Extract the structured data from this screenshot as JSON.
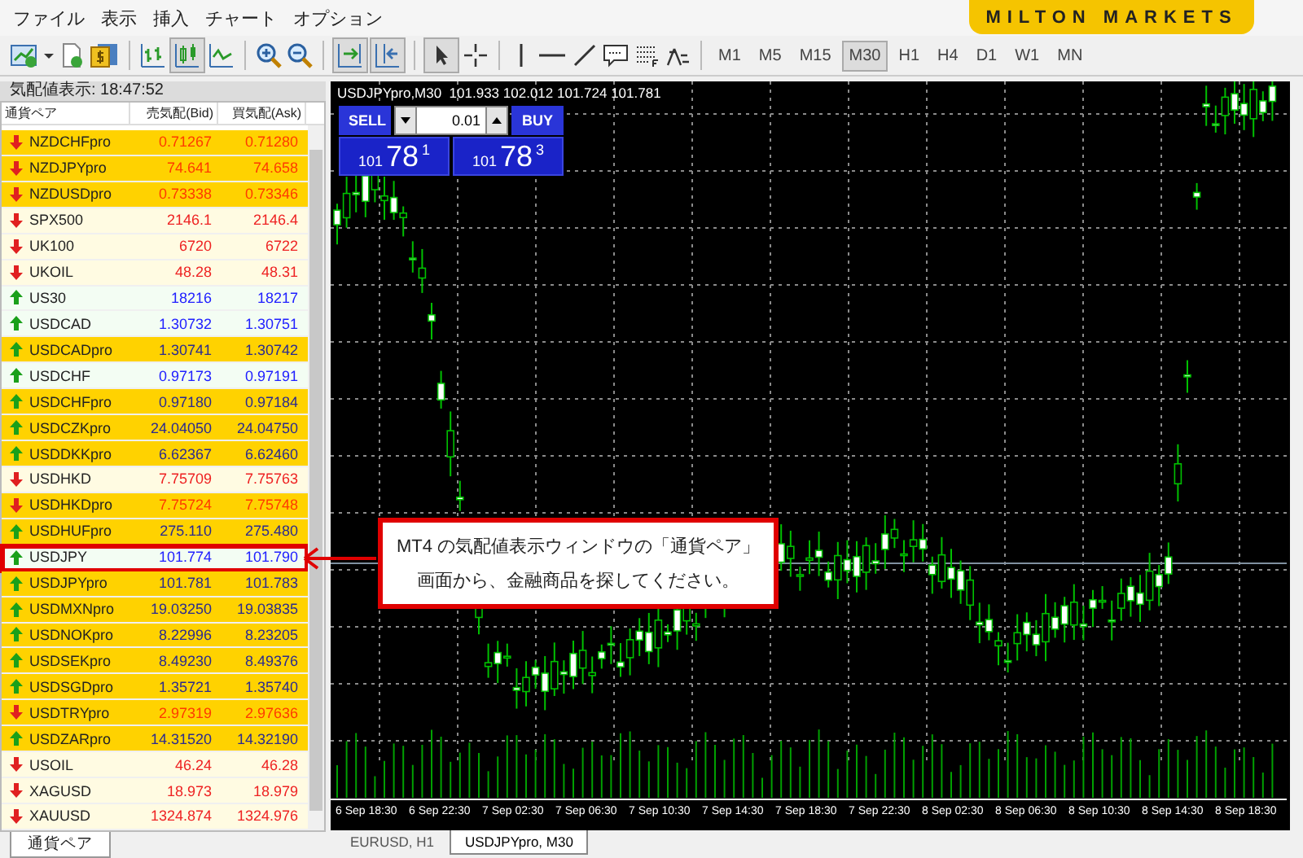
{
  "menu": [
    "ファイル",
    "表示",
    "挿入",
    "チャート",
    "オプション"
  ],
  "logo": "MILTON MARKETS",
  "timeframes": [
    {
      "label": "M1",
      "selected": false
    },
    {
      "label": "M5",
      "selected": false
    },
    {
      "label": "M15",
      "selected": false
    },
    {
      "label": "M30",
      "selected": true
    },
    {
      "label": "H1",
      "selected": false
    },
    {
      "label": "H4",
      "selected": false
    },
    {
      "label": "D1",
      "selected": false
    },
    {
      "label": "W1",
      "selected": false
    },
    {
      "label": "MN",
      "selected": false
    }
  ],
  "market_watch": {
    "title": "気配値表示: 18:47:52",
    "columns": [
      "通貨ペア",
      "売気配(Bid)",
      "買気配(Ask)"
    ],
    "rows": [
      {
        "symbol": "NZDCHFpro",
        "bid": "0.71267",
        "ask": "0.71280",
        "rising": false,
        "kind": "pro",
        "selected": false
      },
      {
        "symbol": "NZDJPYpro",
        "bid": "74.641",
        "ask": "74.658",
        "rising": false,
        "kind": "pro",
        "selected": false
      },
      {
        "symbol": "NZDUSDpro",
        "bid": "0.73338",
        "ask": "0.73346",
        "rising": false,
        "kind": "pro",
        "selected": false
      },
      {
        "symbol": "SPX500",
        "bid": "2146.1",
        "ask": "2146.4",
        "rising": false,
        "kind": "standard",
        "selected": false
      },
      {
        "symbol": "UK100",
        "bid": "6720",
        "ask": "6722",
        "rising": false,
        "kind": "standard",
        "selected": false
      },
      {
        "symbol": "UKOIL",
        "bid": "48.28",
        "ask": "48.31",
        "rising": false,
        "kind": "standard",
        "selected": false
      },
      {
        "symbol": "US30",
        "bid": "18216",
        "ask": "18217",
        "rising": true,
        "kind": "standard",
        "selected": false
      },
      {
        "symbol": "USDCAD",
        "bid": "1.30732",
        "ask": "1.30751",
        "rising": true,
        "kind": "standard",
        "selected": false
      },
      {
        "symbol": "USDCADpro",
        "bid": "1.30741",
        "ask": "1.30742",
        "rising": true,
        "kind": "pro",
        "selected": false
      },
      {
        "symbol": "USDCHF",
        "bid": "0.97173",
        "ask": "0.97191",
        "rising": true,
        "kind": "standard",
        "selected": false
      },
      {
        "symbol": "USDCHFpro",
        "bid": "0.97180",
        "ask": "0.97184",
        "rising": true,
        "kind": "pro",
        "selected": false
      },
      {
        "symbol": "USDCZKpro",
        "bid": "24.04050",
        "ask": "24.04750",
        "rising": true,
        "kind": "pro",
        "selected": false
      },
      {
        "symbol": "USDDKKpro",
        "bid": "6.62367",
        "ask": "6.62460",
        "rising": true,
        "kind": "pro",
        "selected": false
      },
      {
        "symbol": "USDHKD",
        "bid": "7.75709",
        "ask": "7.75763",
        "rising": false,
        "kind": "standard",
        "selected": false
      },
      {
        "symbol": "USDHKDpro",
        "bid": "7.75724",
        "ask": "7.75748",
        "rising": false,
        "kind": "pro",
        "selected": false
      },
      {
        "symbol": "USDHUFpro",
        "bid": "275.110",
        "ask": "275.480",
        "rising": true,
        "kind": "pro",
        "selected": false
      },
      {
        "symbol": "USDJPY",
        "bid": "101.774",
        "ask": "101.790",
        "rising": true,
        "kind": "standard",
        "selected": true
      },
      {
        "symbol": "USDJPYpro",
        "bid": "101.781",
        "ask": "101.783",
        "rising": true,
        "kind": "pro",
        "selected": false
      },
      {
        "symbol": "USDMXNpro",
        "bid": "19.03250",
        "ask": "19.03835",
        "rising": true,
        "kind": "pro",
        "selected": false
      },
      {
        "symbol": "USDNOKpro",
        "bid": "8.22996",
        "ask": "8.23205",
        "rising": true,
        "kind": "pro",
        "selected": false
      },
      {
        "symbol": "USDSEKpro",
        "bid": "8.49230",
        "ask": "8.49376",
        "rising": true,
        "kind": "pro",
        "selected": false
      },
      {
        "symbol": "USDSGDpro",
        "bid": "1.35721",
        "ask": "1.35740",
        "rising": true,
        "kind": "pro",
        "selected": false
      },
      {
        "symbol": "USDTRYpro",
        "bid": "2.97319",
        "ask": "2.97636",
        "rising": false,
        "kind": "pro",
        "selected": false
      },
      {
        "symbol": "USDZARpro",
        "bid": "14.31520",
        "ask": "14.32190",
        "rising": true,
        "kind": "pro",
        "selected": false
      },
      {
        "symbol": "USOIL",
        "bid": "46.24",
        "ask": "46.28",
        "rising": false,
        "kind": "standard",
        "selected": false
      },
      {
        "symbol": "XAGUSD",
        "bid": "18.973",
        "ask": "18.979",
        "rising": false,
        "kind": "standard",
        "selected": false
      },
      {
        "symbol": "XAUUSD",
        "bid": "1324.874",
        "ask": "1324.976",
        "rising": false,
        "kind": "standard",
        "selected": false
      }
    ],
    "tabs": [
      {
        "label": "通貨ペア",
        "selected": true
      }
    ]
  },
  "chart": {
    "header": "USDJPYpro,M30  101.933 102.012 101.724 101.781",
    "trade_panel": {
      "sell": "SELL",
      "buy": "BUY",
      "lot": "0.01",
      "sell_price": {
        "prefix": "101",
        "big": "78",
        "sup": "1"
      },
      "buy_price": {
        "prefix": "101",
        "big": "78",
        "sup": "3"
      }
    },
    "time_labels": [
      "6 Sep 18:30",
      "6 Sep 22:30",
      "7 Sep 02:30",
      "7 Sep 06:30",
      "7 Sep 10:30",
      "7 Sep 14:30",
      "7 Sep 18:30",
      "7 Sep 22:30",
      "8 Sep 02:30",
      "8 Sep 06:30",
      "8 Sep 10:30",
      "8 Sep 14:30",
      "8 Sep 18:30"
    ],
    "tabs": [
      {
        "label": "EURUSD, H1",
        "selected": false
      },
      {
        "label": "USDJPYpro, M30",
        "selected": true
      }
    ]
  },
  "callout": {
    "lines": [
      "MT4 の気配値表示ウィンドウの「通貨ペア」",
      "画面から、金融商品を探してください。"
    ]
  }
}
